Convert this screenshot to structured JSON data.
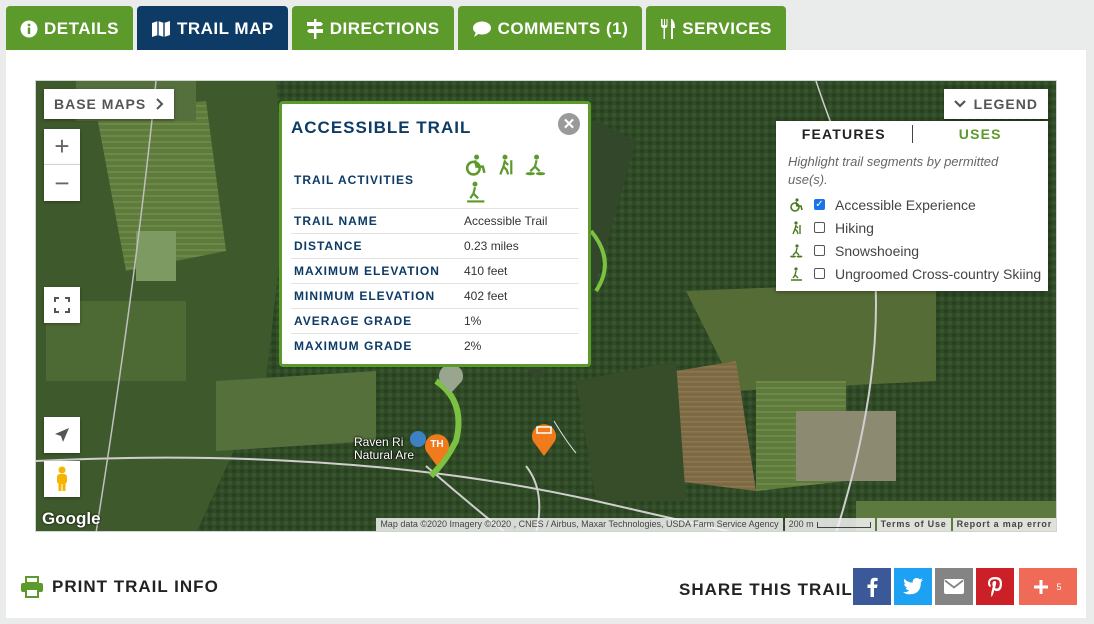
{
  "tabs": [
    {
      "label": "DETAILS",
      "icon": "info-icon"
    },
    {
      "label": "TRAIL MAP",
      "icon": "map-icon",
      "active": true
    },
    {
      "label": "DIRECTIONS",
      "icon": "signpost-icon"
    },
    {
      "label": "COMMENTS (1)",
      "icon": "comment-icon"
    },
    {
      "label": "SERVICES",
      "icon": "fork-knife-icon"
    }
  ],
  "colors": {
    "tab_green": "#5c9a2b",
    "tab_active": "#0d3b66",
    "popup_border": "#5c9a2b",
    "trail_line": "#7bc142"
  },
  "map": {
    "base_maps_label": "BASE MAPS",
    "zoom_in": "+",
    "zoom_out": "−",
    "google_logo": "Google",
    "attribution": "Map data ©2020 Imagery ©2020 , CNES / Airbus, Maxar Technologies, USDA Farm Service Agency",
    "scale": "200 m",
    "terms": "Terms of Use",
    "report": "Report a map error",
    "place_label_line1": "Raven Ri",
    "place_label_line2": "Natural Are"
  },
  "legend": {
    "button_label": "LEGEND",
    "tab_features": "FEATURES",
    "tab_uses": "USES",
    "description": "Highlight trail segments by permitted use(s).",
    "items": [
      {
        "label": "Accessible Experience",
        "checked": true,
        "icon": "wheelchair-icon"
      },
      {
        "label": "Hiking",
        "checked": false,
        "icon": "hiker-icon"
      },
      {
        "label": "Snowshoeing",
        "checked": false,
        "icon": "snowshoe-icon"
      },
      {
        "label": "Ungroomed Cross-country Skiing",
        "checked": false,
        "icon": "skier-icon"
      }
    ]
  },
  "popup": {
    "title": "ACCESSIBLE TRAIL",
    "activities_label": "TRAIL ACTIVITIES",
    "rows": [
      {
        "key": "TRAIL NAME",
        "value": "Accessible Trail"
      },
      {
        "key": "DISTANCE",
        "value": "0.23 miles"
      },
      {
        "key": "MAXIMUM ELEVATION",
        "value": "410 feet"
      },
      {
        "key": "MINIMUM ELEVATION",
        "value": "402 feet"
      },
      {
        "key": "AVERAGE GRADE",
        "value": "1%"
      },
      {
        "key": "MAXIMUM GRADE",
        "value": "2%"
      }
    ]
  },
  "footer": {
    "print_label": "PRINT TRAIL INFO",
    "share_label": "SHARE THIS TRAIL",
    "share_more_count": "5"
  }
}
